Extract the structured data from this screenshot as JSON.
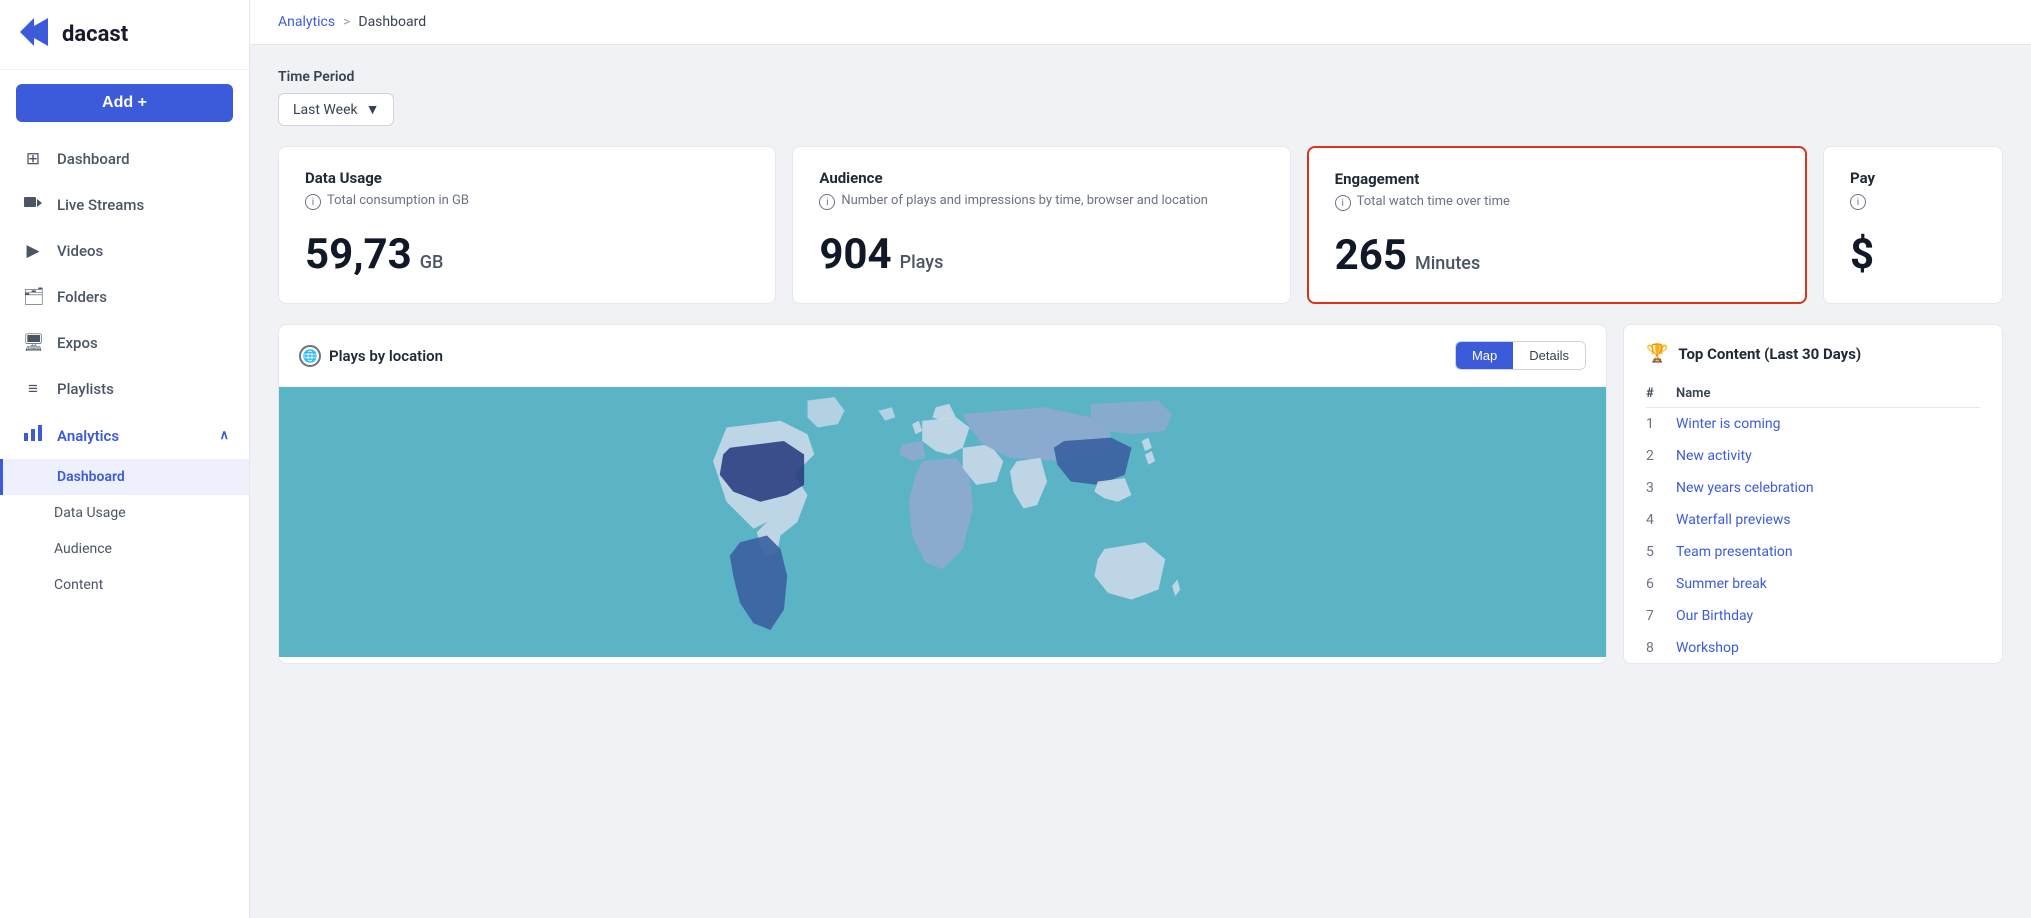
{
  "app": {
    "logo_text": "dacast",
    "add_button_label": "Add +"
  },
  "sidebar": {
    "nav_items": [
      {
        "id": "dashboard",
        "label": "Dashboard",
        "icon": "⊞"
      },
      {
        "id": "live-streams",
        "label": "Live Streams",
        "icon": "🎥"
      },
      {
        "id": "videos",
        "label": "Videos",
        "icon": "▶"
      },
      {
        "id": "folders",
        "label": "Folders",
        "icon": "🗂"
      },
      {
        "id": "expos",
        "label": "Expos",
        "icon": "🖥"
      },
      {
        "id": "playlists",
        "label": "Playlists",
        "icon": "≡"
      },
      {
        "id": "analytics",
        "label": "Analytics",
        "icon": "📊",
        "active": true,
        "expanded": true
      }
    ],
    "analytics_sub": [
      {
        "id": "analytics-dashboard",
        "label": "Dashboard",
        "active": true
      },
      {
        "id": "analytics-data-usage",
        "label": "Data Usage"
      },
      {
        "id": "analytics-audience",
        "label": "Audience"
      },
      {
        "id": "analytics-content",
        "label": "Content"
      }
    ]
  },
  "breadcrumb": {
    "parent": "Analytics",
    "separator": ">",
    "current": "Dashboard"
  },
  "time_period": {
    "label": "Time Period",
    "value": "Last Week"
  },
  "stats": {
    "data_usage": {
      "title": "Data Usage",
      "subtitle": "Total consumption in GB",
      "value": "59,73",
      "unit": "GB"
    },
    "audience": {
      "title": "Audience",
      "subtitle": "Number of plays and impressions by time, browser and location",
      "value": "904",
      "unit": "Plays"
    },
    "engagement": {
      "title": "Engagement",
      "subtitle": "Total watch time over time",
      "value": "265",
      "unit": "Minutes"
    },
    "pay": {
      "title": "Pay",
      "subtitle": "",
      "partial_symbol": "$"
    }
  },
  "map": {
    "title": "Plays by location",
    "toggle_map": "Map",
    "toggle_details": "Details"
  },
  "top_content": {
    "title": "Top Content (Last 30 Days)",
    "col_rank": "#",
    "col_name": "Name",
    "items": [
      {
        "rank": 1,
        "name": "Winter is coming"
      },
      {
        "rank": 2,
        "name": "New activity"
      },
      {
        "rank": 3,
        "name": "New years celebration"
      },
      {
        "rank": 4,
        "name": "Waterfall previews"
      },
      {
        "rank": 5,
        "name": "Team presentation"
      },
      {
        "rank": 6,
        "name": "Summer break"
      },
      {
        "rank": 7,
        "name": "Our Birthday"
      },
      {
        "rank": 8,
        "name": "Workshop"
      }
    ]
  },
  "colors": {
    "accent": "#3b5bdb",
    "highlight_border": "#d9341c",
    "map_sea": "#5ab4c5",
    "map_land_light": "#c8d8e8",
    "map_land_mid": "#8fa8d0",
    "map_land_dark": "#3a5fa0",
    "map_land_highlight": "#2a3f80"
  }
}
